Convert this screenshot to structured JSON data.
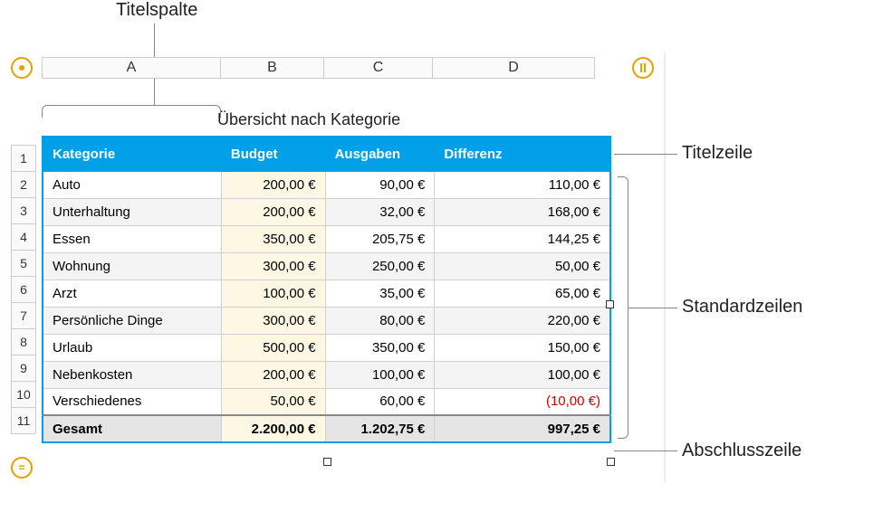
{
  "callouts": {
    "titelspalte": "Titelspalte",
    "titelzeile": "Titelzeile",
    "standardzeilen": "Standardzeilen",
    "abschlusszeile": "Abschlusszeile"
  },
  "column_letters": [
    "A",
    "B",
    "C",
    "D"
  ],
  "row_numbers": [
    "1",
    "2",
    "3",
    "4",
    "5",
    "6",
    "7",
    "8",
    "9",
    "10",
    "11"
  ],
  "table_title": "Übersicht nach Kategorie",
  "headers": {
    "kategorie": "Kategorie",
    "budget": "Budget",
    "ausgaben": "Ausgaben",
    "differenz": "Differenz"
  },
  "rows": [
    {
      "kategorie": "Auto",
      "budget": "200,00 €",
      "ausgaben": "90,00 €",
      "differenz": "110,00 €"
    },
    {
      "kategorie": "Unterhaltung",
      "budget": "200,00 €",
      "ausgaben": "32,00 €",
      "differenz": "168,00 €"
    },
    {
      "kategorie": "Essen",
      "budget": "350,00 €",
      "ausgaben": "205,75 €",
      "differenz": "144,25 €"
    },
    {
      "kategorie": "Wohnung",
      "budget": "300,00 €",
      "ausgaben": "250,00 €",
      "differenz": "50,00 €"
    },
    {
      "kategorie": "Arzt",
      "budget": "100,00 €",
      "ausgaben": "35,00 €",
      "differenz": "65,00 €"
    },
    {
      "kategorie": "Persönliche Dinge",
      "budget": "300,00 €",
      "ausgaben": "80,00 €",
      "differenz": "220,00 €"
    },
    {
      "kategorie": "Urlaub",
      "budget": "500,00 €",
      "ausgaben": "350,00 €",
      "differenz": "150,00 €"
    },
    {
      "kategorie": "Nebenkosten",
      "budget": "200,00 €",
      "ausgaben": "100,00 €",
      "differenz": "100,00 €"
    },
    {
      "kategorie": "Verschiedenes",
      "budget": "50,00 €",
      "ausgaben": "60,00 €",
      "differenz": "(10,00 €)",
      "neg": true
    }
  ],
  "footer": {
    "label": "Gesamt",
    "budget": "2.200,00 €",
    "ausgaben": "1.202,75 €",
    "differenz": "997,25 €"
  }
}
